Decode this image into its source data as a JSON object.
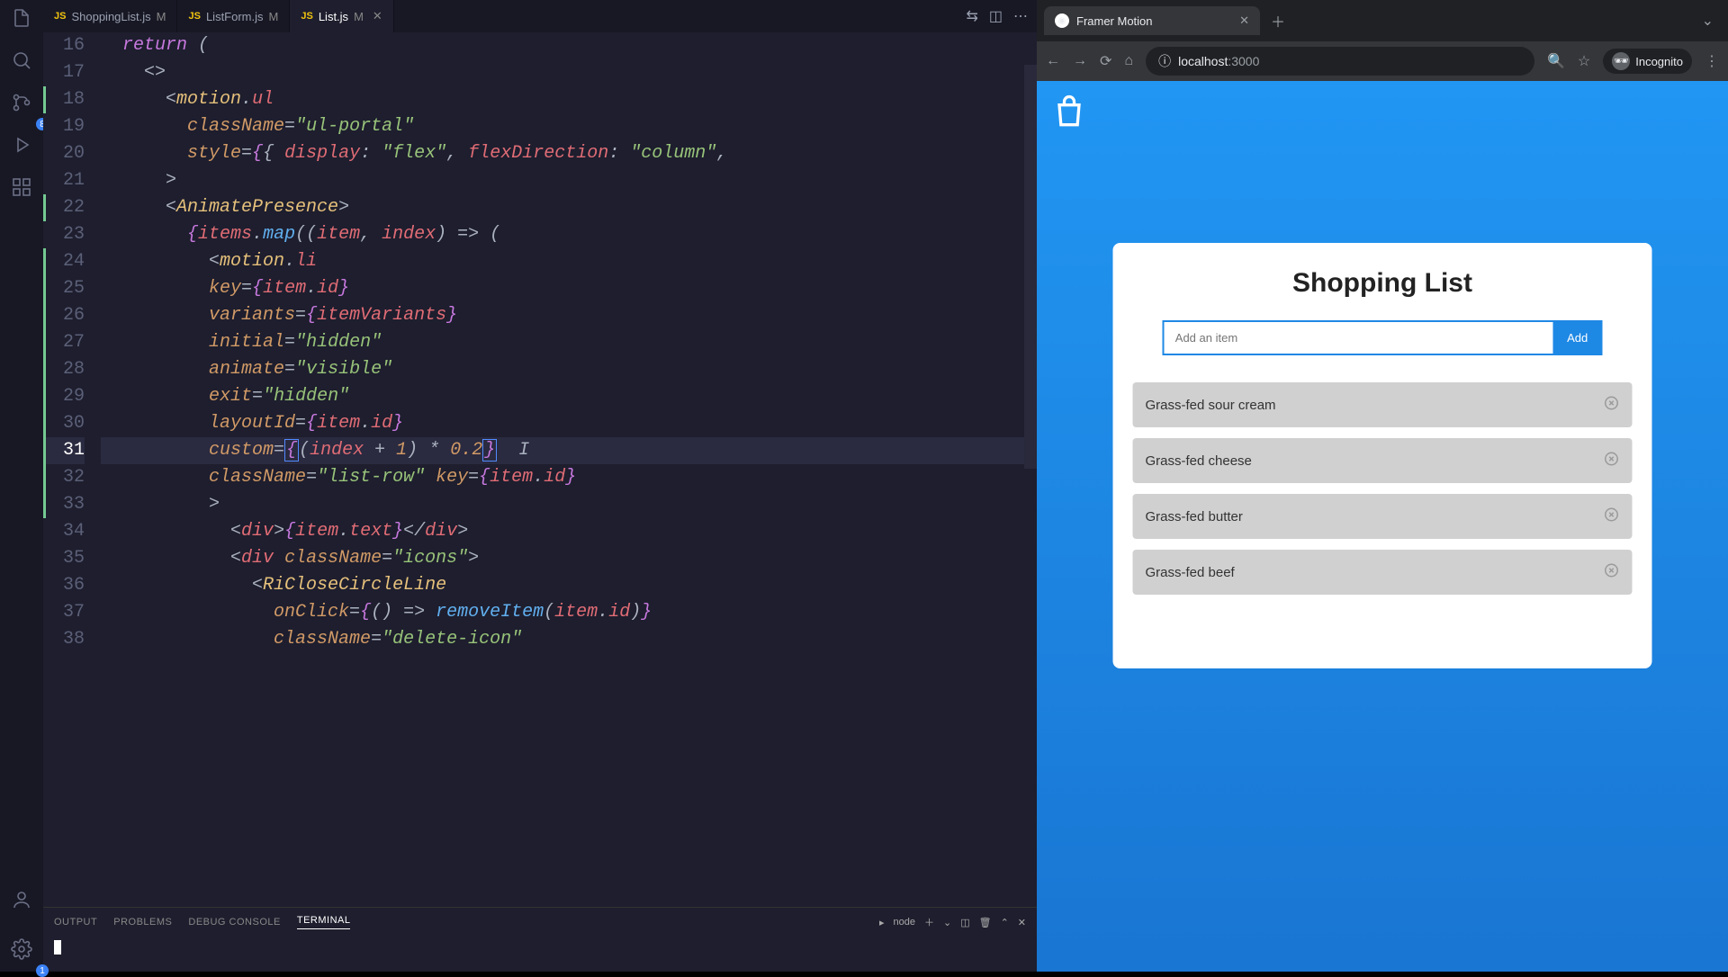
{
  "editor": {
    "tabs": [
      {
        "icon": "JS",
        "name": "ShoppingList.js",
        "mod": "M",
        "active": false
      },
      {
        "icon": "JS",
        "name": "ListForm.js",
        "mod": "M",
        "active": false
      },
      {
        "icon": "JS",
        "name": "List.js",
        "mod": "M",
        "active": true
      }
    ],
    "activity_badge": "8",
    "status_badge": "1",
    "lines": [
      {
        "n": 16,
        "html": "  <span class='kw'>return</span> <span class='punc'>(</span>"
      },
      {
        "n": 17,
        "html": "    <span class='punc'>&lt;&gt;</span>"
      },
      {
        "n": 18,
        "html": "      <span class='punc'>&lt;</span><span class='comp'>motion</span><span class='punc'>.</span><span class='tag'>ul</span>",
        "git": true
      },
      {
        "n": 19,
        "html": "        <span class='attr'>className</span><span class='punc'>=</span><span class='str'>\"ul-portal\"</span>"
      },
      {
        "n": 20,
        "html": "        <span class='attr'>style</span><span class='punc'>=</span><span class='brace'>{</span><span class='punc'>{</span> <span class='var'>display</span><span class='punc'>:</span> <span class='str'>\"flex\"</span><span class='punc'>,</span> <span class='var'>flexDirection</span><span class='punc'>:</span> <span class='str'>\"column\"</span><span class='punc'>,</span>"
      },
      {
        "n": 21,
        "html": "      <span class='punc'>&gt;</span>"
      },
      {
        "n": 22,
        "html": "      <span class='punc'>&lt;</span><span class='comp'>AnimatePresence</span><span class='punc'>&gt;</span>",
        "git": true
      },
      {
        "n": 23,
        "html": "        <span class='brace'>{</span><span class='var'>items</span><span class='punc'>.</span><span class='fn'>map</span><span class='punc'>((</span><span class='var'>item</span><span class='punc'>,</span> <span class='var'>index</span><span class='punc'>) =&gt; (</span>"
      },
      {
        "n": 24,
        "html": "          <span class='punc'>&lt;</span><span class='comp'>motion</span><span class='punc'>.</span><span class='tag'>li</span>",
        "git": true
      },
      {
        "n": 25,
        "html": "          <span class='attr'>key</span><span class='punc'>=</span><span class='brace'>{</span><span class='var'>item</span><span class='punc'>.</span><span class='var'>id</span><span class='brace'>}</span>",
        "git": true
      },
      {
        "n": 26,
        "html": "          <span class='attr'>variants</span><span class='punc'>=</span><span class='brace'>{</span><span class='var'>itemVariants</span><span class='brace'>}</span>",
        "git": true
      },
      {
        "n": 27,
        "html": "          <span class='attr'>initial</span><span class='punc'>=</span><span class='str'>\"hidden\"</span>",
        "git": true
      },
      {
        "n": 28,
        "html": "          <span class='attr'>animate</span><span class='punc'>=</span><span class='str'>\"visible\"</span>",
        "git": true
      },
      {
        "n": 29,
        "html": "          <span class='attr'>exit</span><span class='punc'>=</span><span class='str'>\"hidden\"</span>",
        "git": true
      },
      {
        "n": 30,
        "html": "          <span class='attr'>layoutId</span><span class='punc'>=</span><span class='brace'>{</span><span class='var'>item</span><span class='punc'>.</span><span class='var'>id</span><span class='brace'>}</span>",
        "git": true
      },
      {
        "n": 31,
        "html": "          <span class='attr'>custom</span><span class='punc'>=</span><span class='brace box'>{</span><span class='punc'>(</span><span class='var'>index</span> <span class='punc'>+</span> <span class='num'>1</span><span class='punc'>)</span> <span class='punc'>*</span> <span class='num'>0.2</span><span class='brace box'>}</span>  <span class='punc'>I</span>",
        "git": true,
        "current": true
      },
      {
        "n": 32,
        "html": "          <span class='attr'>className</span><span class='punc'>=</span><span class='str'>\"list-row\"</span> <span class='attr'>key</span><span class='punc'>=</span><span class='brace'>{</span><span class='var'>item</span><span class='punc'>.</span><span class='var'>id</span><span class='brace'>}</span>",
        "git": true
      },
      {
        "n": 33,
        "html": "          <span class='punc'>&gt;</span>",
        "git": true
      },
      {
        "n": 34,
        "html": "            <span class='punc'>&lt;</span><span class='tag'>div</span><span class='punc'>&gt;</span><span class='brace'>{</span><span class='var'>item</span><span class='punc'>.</span><span class='var'>text</span><span class='brace'>}</span><span class='punc'>&lt;/</span><span class='tag'>div</span><span class='punc'>&gt;</span>"
      },
      {
        "n": 35,
        "html": "            <span class='punc'>&lt;</span><span class='tag'>div</span> <span class='attr'>className</span><span class='punc'>=</span><span class='str'>\"icons\"</span><span class='punc'>&gt;</span>"
      },
      {
        "n": 36,
        "html": "              <span class='punc'>&lt;</span><span class='comp'>RiCloseCircleLine</span>"
      },
      {
        "n": 37,
        "html": "                <span class='attr'>onClick</span><span class='punc'>=</span><span class='brace'>{</span><span class='punc'>() =&gt;</span> <span class='fn'>removeItem</span><span class='punc'>(</span><span class='var'>item</span><span class='punc'>.</span><span class='var'>id</span><span class='punc'>)</span><span class='brace'>}</span>"
      },
      {
        "n": 38,
        "html": "                <span class='attr'>className</span><span class='punc'>=</span><span class='str'>\"delete-icon\"</span>"
      }
    ],
    "panel": {
      "tabs": [
        "OUTPUT",
        "PROBLEMS",
        "DEBUG CONSOLE",
        "TERMINAL"
      ],
      "active": "TERMINAL",
      "shell": "node"
    }
  },
  "browser": {
    "tab_title": "Framer Motion",
    "url_host": "localhost",
    "url_port": ":3000",
    "incognito": "Incognito",
    "app": {
      "title": "Shopping List",
      "placeholder": "Add an item",
      "add_label": "Add",
      "items": [
        "Grass-fed sour cream",
        "Grass-fed cheese",
        "Grass-fed butter",
        "Grass-fed beef"
      ]
    }
  }
}
